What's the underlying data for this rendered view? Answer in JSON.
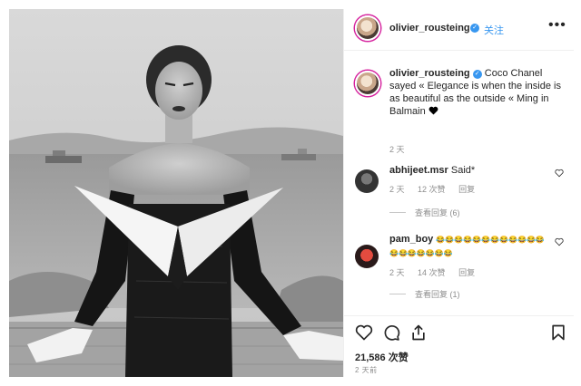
{
  "author": {
    "username": "olivier_rousteing",
    "verified_icon": "verified-badge-icon",
    "follow_label": "关注",
    "more_label": "•••"
  },
  "caption": {
    "username": "olivier_rousteing",
    "text": "Coco Chanel sayed « Elegance is when the inside is as beautiful as the outside « Ming in Balmain",
    "emoji_icon": "black-heart-icon",
    "time": "2 天"
  },
  "comments": [
    {
      "username": "abhijeet.msr",
      "text": "Said*",
      "time": "2 天",
      "likes": "12 次赞",
      "reply_label": "回复",
      "view_replies": "查看回复 (6)"
    },
    {
      "username": "pam_boy",
      "text": "😂😂😂😂😂😂😂😂😂😂😂😂😂😂😂😂😂😂😂",
      "time": "2 天",
      "likes": "14 次赞",
      "reply_label": "回复",
      "view_replies": "查看回复 (1)"
    }
  ],
  "actions": {
    "like_icon": "heart-outline-icon",
    "comment_icon": "comment-icon",
    "share_icon": "share-icon",
    "save_icon": "bookmark-icon"
  },
  "likes_count": "21,586 次赞",
  "post_time": "2 天前",
  "colors": {
    "link_blue": "#3897f0",
    "meta_gray": "#8e8e8e",
    "text": "#262626",
    "border": "#efefef"
  }
}
